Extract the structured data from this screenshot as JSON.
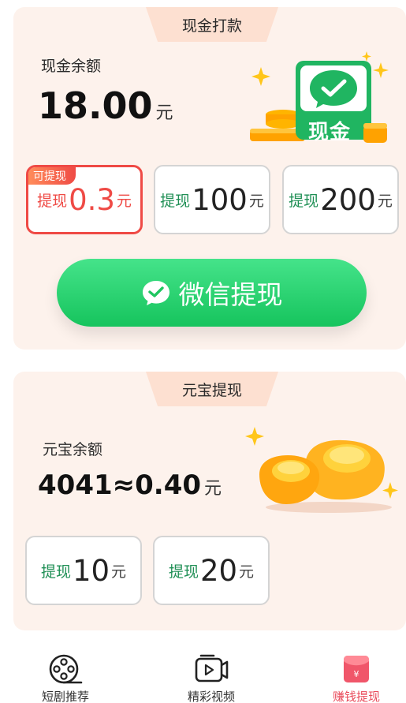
{
  "cash": {
    "tab_title": "现金打款",
    "balance_label": "现金余额",
    "balance_value": "18.00",
    "unit": "元",
    "badge_text": "现金",
    "options": [
      {
        "badge": "可提现",
        "prefix": "提现",
        "amount": "0.3",
        "suffix": "元",
        "selected": true
      },
      {
        "prefix": "提现",
        "amount": "100",
        "suffix": "元"
      },
      {
        "prefix": "提现",
        "amount": "200",
        "suffix": "元"
      }
    ],
    "wechat_button_label": "微信提现"
  },
  "ingot": {
    "tab_title": "元宝提现",
    "balance_label": "元宝余额",
    "balance_value": "4041≈0.40",
    "unit": "元",
    "options": [
      {
        "prefix": "提现",
        "amount": "10",
        "suffix": "元"
      },
      {
        "prefix": "提现",
        "amount": "20",
        "suffix": "元"
      }
    ]
  },
  "tabbar": {
    "items": [
      {
        "label": "短剧推荐",
        "icon": "film-reel-icon"
      },
      {
        "label": "精彩视频",
        "icon": "video-play-icon"
      },
      {
        "label": "赚钱提现",
        "icon": "red-envelope-icon",
        "active": true
      }
    ]
  },
  "colors": {
    "accent_green": "#16c45d",
    "selected_red": "#ef4a45",
    "card_bg": "#fdf2ec",
    "tab_bg": "#fde0d1",
    "active_tab": "#e94a5a"
  }
}
